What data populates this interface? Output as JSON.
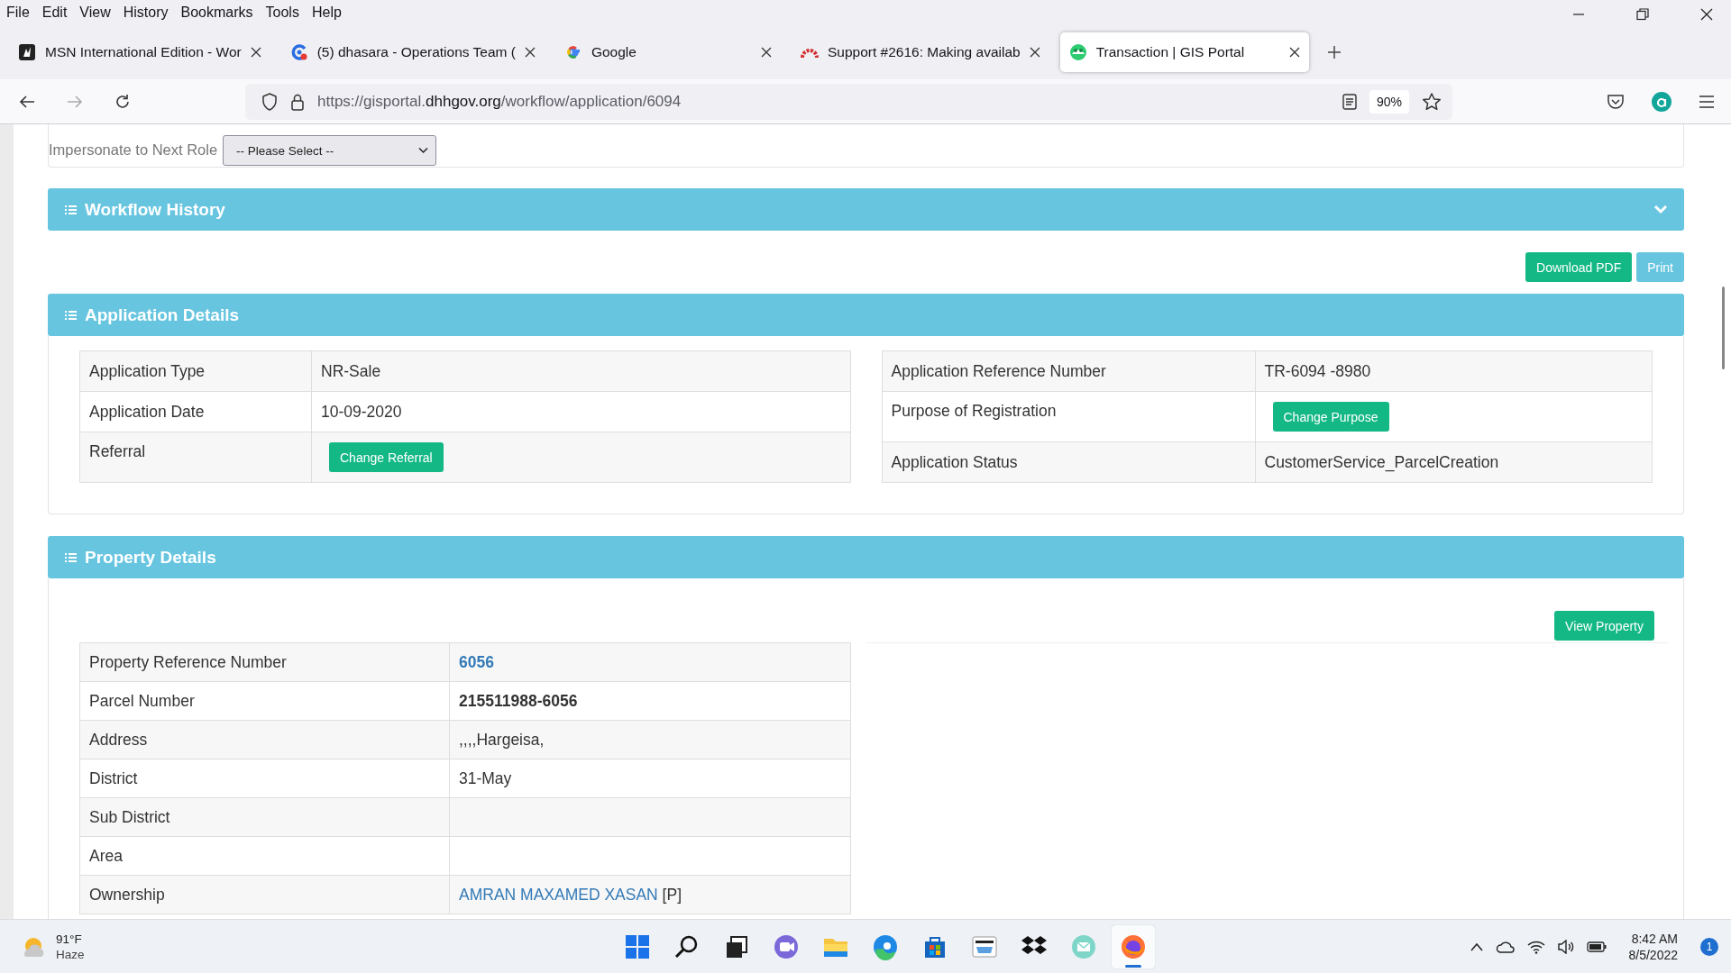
{
  "menu_bar": [
    "File",
    "Edit",
    "View",
    "History",
    "Bookmarks",
    "Tools",
    "Help"
  ],
  "tabs": [
    {
      "title": "MSN International Edition - Wor",
      "selected": false
    },
    {
      "title": "(5) dhasara - Operations Team (",
      "selected": false
    },
    {
      "title": "Google",
      "selected": false
    },
    {
      "title": "Support #2616: Making availab",
      "selected": false
    },
    {
      "title": "Transaction | GIS Portal",
      "selected": true
    }
  ],
  "address_bar": {
    "url_start": "https://gisportal.",
    "url_domain": "dhhgov.org",
    "url_path": "/workflow/application/6094",
    "zoom": "90%"
  },
  "impersonate": {
    "label": "Impersonate to Next Role",
    "select": "-- Please Select --"
  },
  "workflow_history": {
    "title": "Workflow History",
    "expanded": false
  },
  "actions": [
    {
      "label": "Download PDF",
      "kind": "primary"
    },
    {
      "label": "Print",
      "kind": "info"
    }
  ],
  "application_details": {
    "title": "Application Details",
    "left_table": [
      {
        "label": "Application Type",
        "value": "NR-Sale",
        "kind": "text"
      },
      {
        "label": "Application Date",
        "value": "10-09-2020",
        "kind": "text"
      },
      {
        "label": "Referral",
        "value": "Change Referral",
        "kind": "button"
      }
    ],
    "right_table": [
      {
        "label": "Application Reference Number",
        "value": "TR-6094 -8980",
        "kind": "text"
      },
      {
        "label": "Purpose of Registration",
        "value": "Change Purpose",
        "kind": "button"
      },
      {
        "label": "Application Status",
        "value": "CustomerService_ParcelCreation",
        "kind": "text"
      }
    ]
  },
  "property_details": {
    "title": "Property Details",
    "button": "View Property",
    "rows": [
      {
        "label": "Property Reference Number",
        "value": "6056",
        "kind": "link"
      },
      {
        "label": "Parcel Number",
        "value": "215511988-6056",
        "kind": "bold"
      },
      {
        "label": "Address",
        "value": ",,,,Hargeisa,",
        "kind": "text"
      },
      {
        "label": "District",
        "value": "31-May",
        "kind": "text"
      },
      {
        "label": "Sub District",
        "kind": "text"
      },
      {
        "label": "Area",
        "kind": "text"
      },
      {
        "label": "Ownership",
        "value": "AMRAN MAXAMED XASAN",
        "suffix": "[P]",
        "kind": "owner"
      }
    ]
  },
  "taskbar": {
    "weather": {
      "temperature": "91°F",
      "condition": "Haze"
    },
    "apps": [
      {
        "selected": false
      },
      {
        "selected": false
      },
      {
        "selected": false
      },
      {
        "selected": false
      },
      {
        "selected": false
      },
      {
        "selected": false
      },
      {
        "selected": false
      },
      {
        "selected": false
      },
      {
        "selected": false
      },
      {
        "selected": false
      },
      {
        "selected": true
      }
    ],
    "time": "8:42 AM",
    "date": "8/5/2022",
    "notifications": "1"
  }
}
